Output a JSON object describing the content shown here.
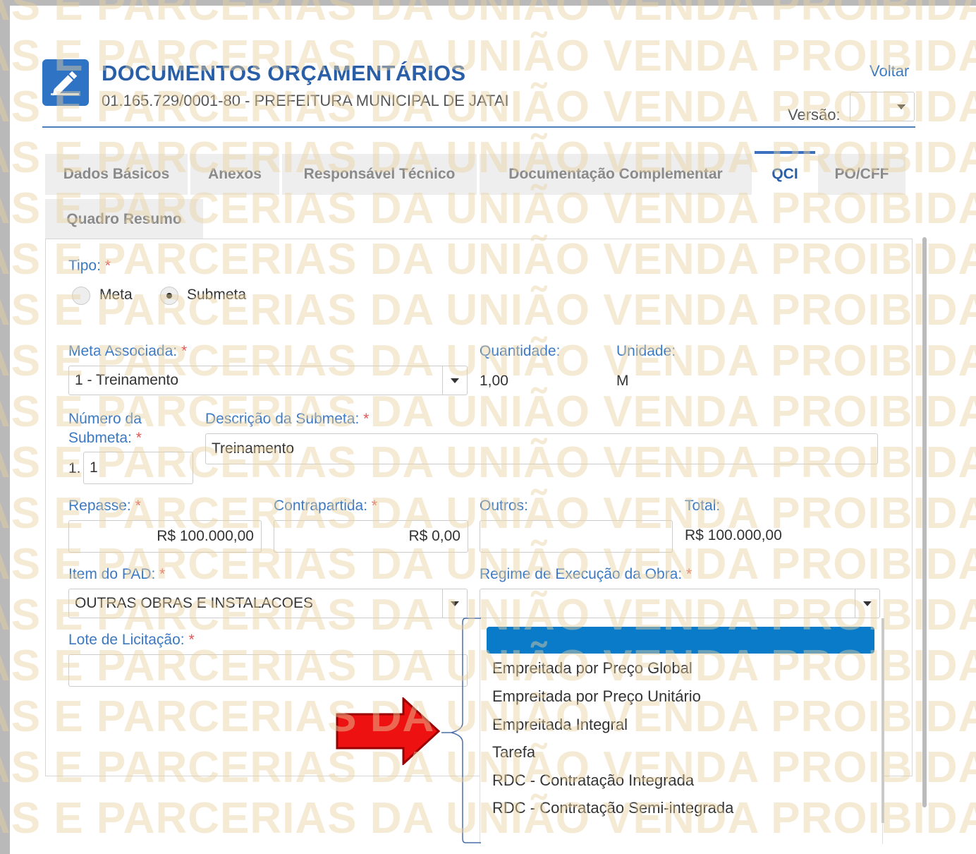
{
  "header": {
    "title": "DOCUMENTOS ORÇAMENTÁRIOS",
    "subtitle": "01.165.729/0001-80 - PREFEITURA MUNICIPAL DE JATAI",
    "voltar": "Voltar",
    "versao_label": "Versão:",
    "icon": "edit-pencil-icon"
  },
  "tabs": [
    {
      "label": "Dados Básicos"
    },
    {
      "label": "Anexos"
    },
    {
      "label": "Responsável Técnico"
    },
    {
      "label": "Documentação Complementar"
    },
    {
      "label": "QCI",
      "active": true
    },
    {
      "label": "PO/CFF"
    },
    {
      "label": "Quadro Resumo"
    }
  ],
  "form": {
    "tipo_label": "Tipo:",
    "required_mark": "*",
    "radio_meta": "Meta",
    "radio_submeta": "Submeta",
    "tipo_selected": "Submeta",
    "meta_associada_label": "Meta Associada:",
    "meta_associada_value": "1 - Treinamento",
    "quantidade_label": "Quantidade:",
    "quantidade_value": "1,00",
    "unidade_label": "Unidade:",
    "unidade_value": "M",
    "numero_submeta_label_1": "Número da",
    "numero_submeta_label_2": "Submeta:",
    "numero_prefix": "1.",
    "numero_value": "1",
    "descricao_label": "Descrição da Submeta:",
    "descricao_value": "Treinamento",
    "repasse_label": "Repasse:",
    "repasse_value": "R$ 100.000,00",
    "contrapartida_label": "Contrapartida:",
    "contrapartida_value": "R$ 0,00",
    "outros_label": "Outros:",
    "outros_value": "",
    "total_label": "Total:",
    "total_value": "R$ 100.000,00",
    "item_pad_label": "Item do PAD:",
    "item_pad_value": "OUTRAS OBRAS E INSTALACOES",
    "regime_label": "Regime de Execução da Obra:",
    "regime_value": "",
    "lote_label": "Lote de Licitação:",
    "lote_value": ""
  },
  "regime_options": [
    "Empreitada por Preço Global",
    "Empreitada por Preço Unitário",
    "Empreitada Integral",
    "Tarefa",
    "RDC - Contratação Integrada",
    "RDC - Contratação Semi-integrada"
  ],
  "watermark": {
    "text": "PARCERIAS DA UNIÃO VENDA PROIBIDA",
    "rows": [
      "AS E PARCERIAS DA UNIÃO VENDA PROIBIDA",
      "AS E PARCERIAS DA UNIÃO VENDA PROIBIDA",
      "AS E PARCERIAS DA UNIÃO VENDA PROIBIDA",
      "AS E PARCERIAS DA UNIÃO VENDA PROIBIDA",
      "AS E PARCERIAS DA UNIÃO VENDA PROIBIDA",
      "AS E PARCERIAS DA UNIÃO VENDA PROIBIDA",
      "AS E PARCERIAS DA UNIÃO VENDA PROIBIDA",
      "AS E PARCERIAS DA UNIÃO VENDA PROIBIDA",
      "AS E PARCERIAS DA UNIÃO VENDA PROIBIDA",
      "AS E PARCERIAS DA UNIÃO VENDA PROIBIDA",
      "AS E PARCERIAS DA UNIÃO VENDA PROIBIDA",
      "AS E PARCERIAS DA UNIÃO VENDA PROIBIDA",
      "AS E PARCERIAS DA UNIÃO VENDA PROIBIDA",
      "AS E PARCERIAS DA UNIÃO VENDA PROIBIDA",
      "AS E PARCERIAS DA UNIÃO VENDA PROIBIDA",
      "AS E PARCERIAS DA UNIÃO VENDA PROIBIDA",
      "AS E PARCERIAS DA UNIÃO VENDA PROIBIDA"
    ]
  },
  "colors": {
    "accent": "#2a5fa8",
    "label_blue": "#3b79c2",
    "required": "#e05555",
    "highlight": "#0a7bc8",
    "arrow_red": "#ee1111"
  }
}
